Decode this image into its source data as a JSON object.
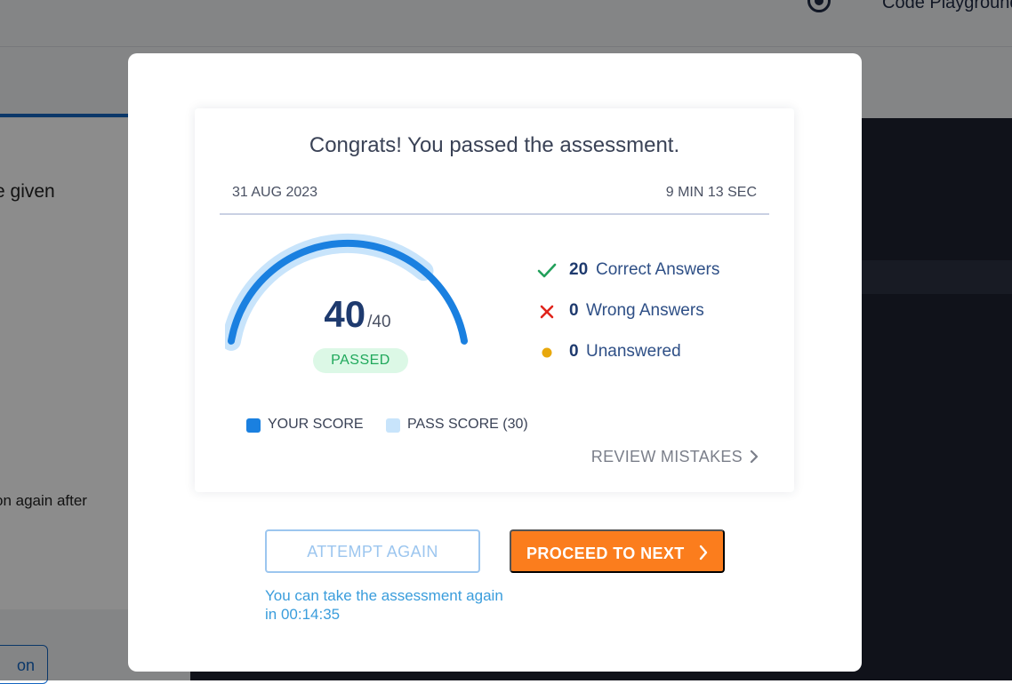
{
  "background": {
    "nav_label": "Code Playground",
    "text_fragment_1": "e given",
    "text_fragment_2": "on again after",
    "button_fragment": "on"
  },
  "modal": {
    "title": "Congrats! You passed the assessment.",
    "date": "31 AUG 2023",
    "duration": "9 MIN 13 SEC",
    "score": {
      "value": "40",
      "total": "/40",
      "status": "PASSED",
      "score_fraction": 1.0,
      "pass_fraction": 0.75
    },
    "stats": [
      {
        "icon": "check-icon",
        "count": "20",
        "label": "Correct Answers",
        "color": "#22a05b"
      },
      {
        "icon": "cross-icon",
        "count": "0",
        "label": "Wrong Answers",
        "color": "#e0241b"
      },
      {
        "icon": "dot-icon",
        "count": "0",
        "label": "Unanswered",
        "color": "#e8a80c"
      }
    ],
    "legend": {
      "your_score": "YOUR SCORE",
      "pass_score": "PASS SCORE (30)"
    },
    "review_label": "REVIEW MISTAKES",
    "attempt_again_label": "ATTEMPT AGAIN",
    "proceed_label": "PROCEED TO NEXT",
    "retake_note": "You can take the assessment again in 00:14:35"
  },
  "colors": {
    "accent": "#1a80e0",
    "pass_band": "#c8e4fb",
    "proceed": "#fb7d1d",
    "passed_badge_bg": "#dcf8e6",
    "passed_badge_text": "#1fa85b"
  }
}
